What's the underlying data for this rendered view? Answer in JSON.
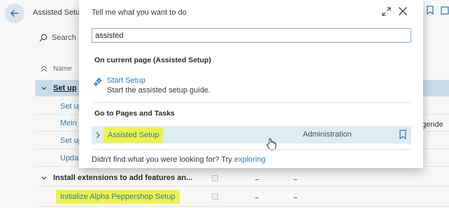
{
  "background": {
    "page_title": "Assisted Setup",
    "search_label": "Search",
    "column_name": "Name",
    "rows": [
      {
        "label": "Set up",
        "style": "bold-link",
        "selected": true
      },
      {
        "label": "Set up",
        "style": "link"
      },
      {
        "label": "Mein",
        "style": "link"
      },
      {
        "label": "Set up",
        "style": "link"
      },
      {
        "label": "Upda",
        "style": "link"
      },
      {
        "label": "Install extensions to add features an...",
        "style": "bold"
      },
      {
        "label": "Initialize Alpha Peppershop Setup",
        "style": "link-highlight"
      }
    ],
    "legend_fragment": "egende",
    "dash_text": "_"
  },
  "modal": {
    "title": "Tell me what you want to do",
    "search_value": "assisted",
    "section_current": "On current page (Assisted Setup)",
    "action": {
      "name": "Start Setup",
      "description": "Start the assisted setup guide."
    },
    "section_pages": "Go to Pages and Tasks",
    "result": {
      "name": "Assisted Setup",
      "category": "Administration"
    },
    "footer": {
      "prefix": "Didn't find what you were looking for? Try ",
      "link": "exploring"
    }
  },
  "colors": {
    "accent": "#2b7cb6",
    "highlight": "#eef245",
    "selected_row": "#dcecf2",
    "background_selected_row": "#c8dbea"
  }
}
